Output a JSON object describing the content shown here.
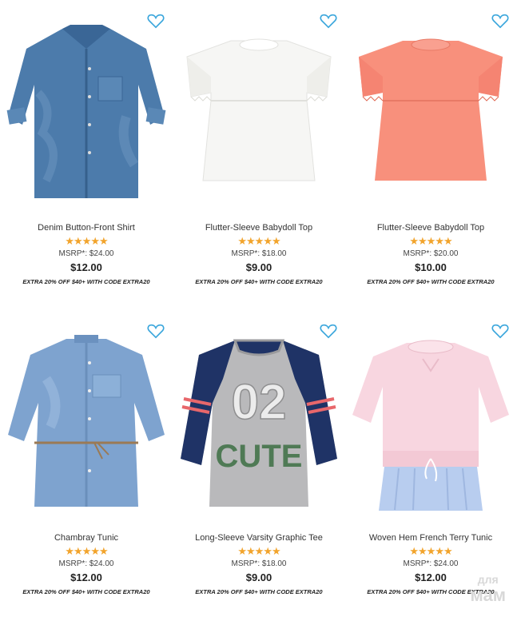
{
  "products": [
    {
      "name": "Denim Button-Front Shirt",
      "stars": "★★★★★",
      "rating": 5,
      "msrp": "MSRP*: $24.00",
      "price": "$12.00",
      "promo": "EXTRA 20% OFF $40+ WITH CODE EXTRA20",
      "image": "denim-shirt"
    },
    {
      "name": "Flutter-Sleeve Babydoll Top",
      "stars": "★★★★★",
      "rating": 5,
      "msrp": "MSRP*: $18.00",
      "price": "$9.00",
      "promo": "EXTRA 20% OFF $40+ WITH CODE EXTRA20",
      "image": "white-babydoll-top"
    },
    {
      "name": "Flutter-Sleeve Babydoll Top",
      "stars": "★★★★★",
      "rating": 5,
      "msrp": "MSRP*: $20.00",
      "price": "$10.00",
      "promo": "EXTRA 20% OFF $40+ WITH CODE EXTRA20",
      "image": "coral-babydoll-top"
    },
    {
      "name": "Chambray Tunic",
      "stars": "★★★★★",
      "rating": 4.5,
      "msrp": "MSRP*: $24.00",
      "price": "$12.00",
      "promo": "EXTRA 20% OFF $40+ WITH CODE EXTRA20",
      "image": "chambray-tunic"
    },
    {
      "name": "Long-Sleeve Varsity Graphic Tee",
      "stars": "★★★★★",
      "rating": 5,
      "msrp": "MSRP*: $18.00",
      "price": "$9.00",
      "promo": "EXTRA 20% OFF $40+ WITH CODE EXTRA20",
      "image": "varsity-graphic-tee",
      "graphic_text": [
        "02",
        "CUTE"
      ]
    },
    {
      "name": "Woven Hem French Terry Tunic",
      "stars": "★★★★★",
      "rating": 5,
      "msrp": "MSRP*: $24.00",
      "price": "$12.00",
      "promo": "EXTRA 20% OFF $40+ WITH CODE EXTRA20",
      "image": "pink-terry-tunic"
    }
  ],
  "icons": {
    "favorite": "heart-outline-icon"
  },
  "colors": {
    "star": "#f2a42c",
    "heart": "#3aa6dc"
  },
  "watermark": {
    "line1": "для",
    "line2": "мам"
  }
}
